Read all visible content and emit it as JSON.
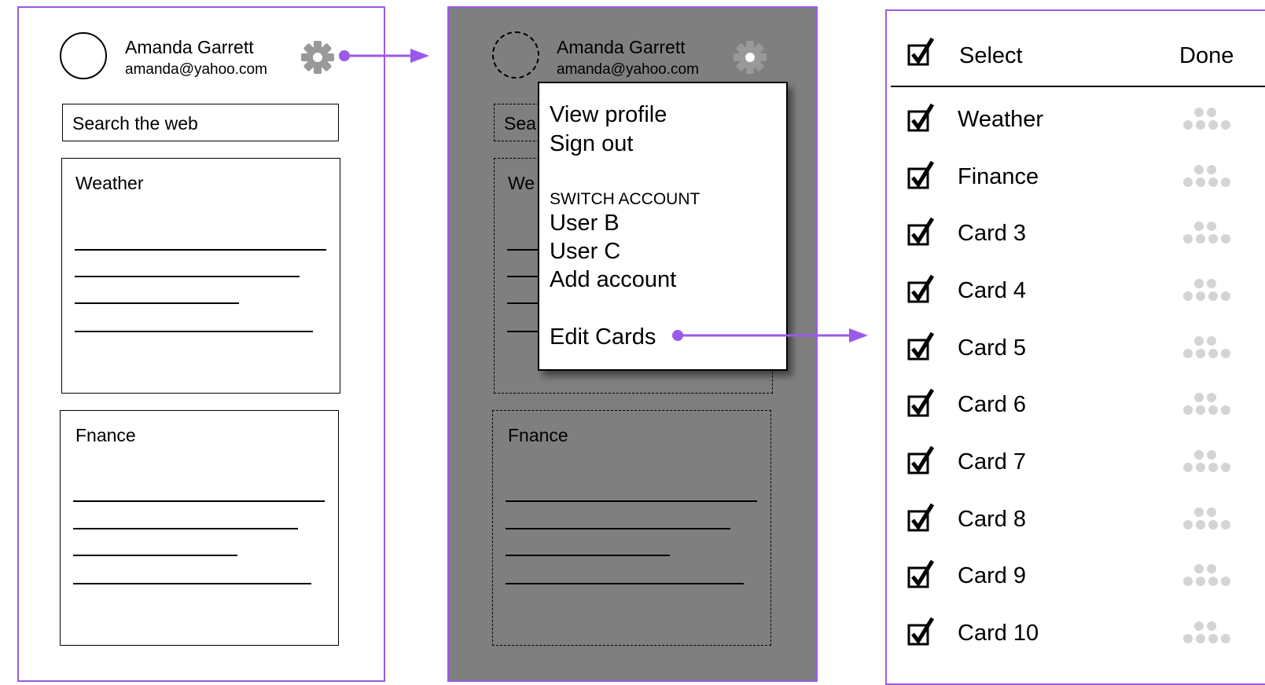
{
  "colors": {
    "accent": "#9b59e8",
    "overlay": "#7f7f7f",
    "gear": "#999999",
    "grip": "#d4d4d4"
  },
  "profile": {
    "name": "Amanda Garrett",
    "email": "amanda@yahoo.com",
    "settings_icon": "gear-icon"
  },
  "screen1": {
    "search_placeholder": "Search the web",
    "cards": [
      {
        "title": "Weather"
      },
      {
        "title": "Fnance"
      }
    ]
  },
  "screen2": {
    "search_partial": "Sea",
    "card1_partial": "We",
    "card2_title": "Fnance",
    "menu": {
      "view_profile": "View profile",
      "sign_out": "Sign out",
      "switch_header": "SWITCH ACCOUNT",
      "accounts": [
        "User B",
        "User C"
      ],
      "add_account": "Add account",
      "edit_cards": "Edit Cards"
    }
  },
  "screen3": {
    "select_label": "Select",
    "done_label": "Done",
    "items": [
      {
        "label": "Weather",
        "checked": true
      },
      {
        "label": "Finance",
        "checked": true
      },
      {
        "label": "Card 3",
        "checked": true
      },
      {
        "label": "Card 4",
        "checked": true
      },
      {
        "label": "Card 5",
        "checked": true
      },
      {
        "label": "Card 6",
        "checked": true
      },
      {
        "label": "Card 7",
        "checked": true
      },
      {
        "label": "Card 8",
        "checked": true
      },
      {
        "label": "Card 9",
        "checked": true
      },
      {
        "label": "Card 10",
        "checked": true
      }
    ]
  }
}
